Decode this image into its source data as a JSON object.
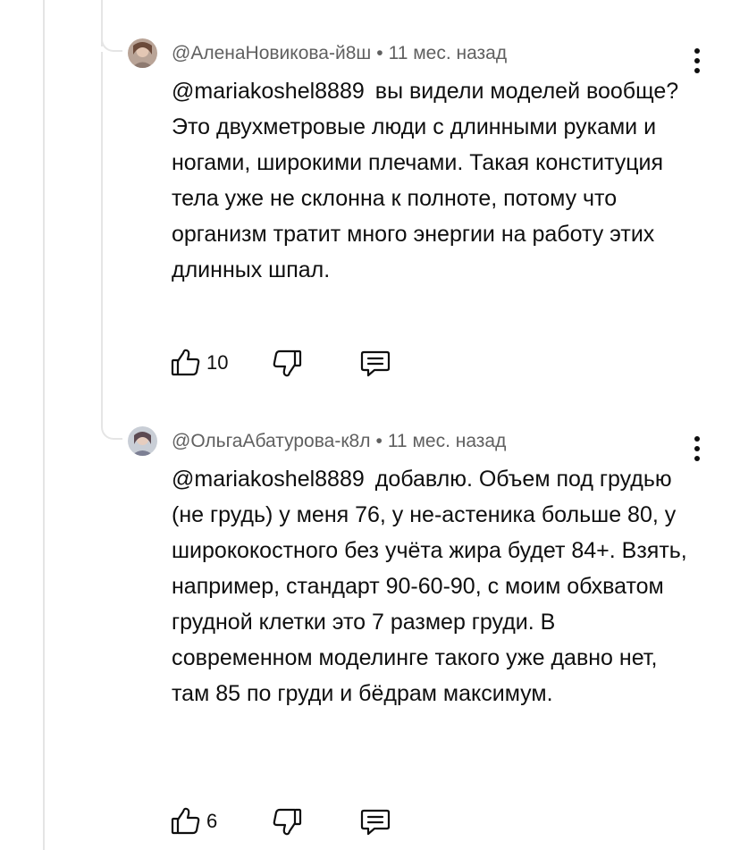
{
  "comments": [
    {
      "author": "@АленаНовикова-й8ш",
      "separator": "•",
      "time": "11 мес. назад",
      "mention": "@mariakoshel8889",
      "text": "вы видели моделей вообще? Это двухметровые люди с длинными руками и ногами, широкими плечами. Такая конституция тела уже не склонна к полноте, потому что организм тратит много энергии на работу этих длинных шпал.",
      "likes": "10",
      "icons": {
        "avatar": "avatar",
        "menu": "more-vert-icon",
        "like": "thumb-up-icon",
        "dislike": "thumb-down-icon",
        "reply": "reply-icon"
      }
    },
    {
      "author": "@ОльгаАбатурова-к8л",
      "separator": "•",
      "time": "11 мес. назад",
      "mention": "@mariakoshel8889",
      "text": "добавлю. Объем под грудью (не грудь) у меня 76, у не-астеника больше 80, у ширококостного без учёта жира будет 84+. Взять, например, стандарт 90-60-90, с моим обхватом грудной клетки это 7 размер груди. В современном моделинге такого уже давно нет, там 85 по груди и бёдрам максимум.",
      "likes": "6",
      "icons": {
        "avatar": "avatar",
        "menu": "more-vert-icon",
        "like": "thumb-up-icon",
        "dislike": "thumb-down-icon",
        "reply": "reply-icon"
      }
    }
  ],
  "colors": {
    "text": "#0f0f0f",
    "meta": "#606060",
    "thread_line": "#e5e5e5"
  }
}
